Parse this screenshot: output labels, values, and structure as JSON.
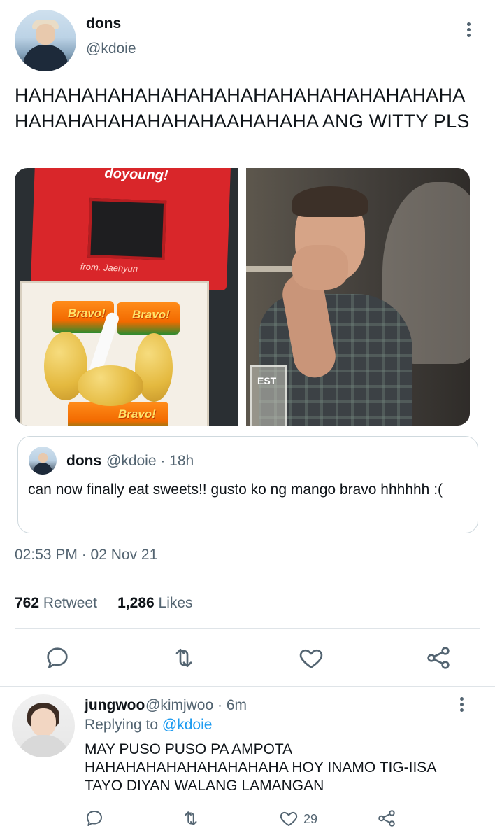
{
  "tweet": {
    "author_name": "dons",
    "author_handle": "@kdoie",
    "text": "HAHAHAHAHAHAHAHAHAHAHAHAHAHAHAHAHA HAHAHAHAHAHAHAHAAHAHAHA ANG WITTY PLS",
    "image_left_texts": {
      "bag_top": "doyoung!",
      "bag_from": "from. Jaehyun",
      "snack_brand": "Bravo!"
    },
    "image_right_texts": {
      "glass_label": "EST"
    },
    "quoted": {
      "author_name": "dons",
      "author_handle": "@kdoie · 18h",
      "text": "can now finally eat sweets!! gusto ko ng mango bravo hhhhhh :("
    },
    "timestamp": "02:53 PM · 02 Nov 21",
    "stats": {
      "retweet_count": "762",
      "retweet_label": "Retweet",
      "like_count": "1,286",
      "like_label": "Likes"
    }
  },
  "reply": {
    "author_name": "jungwoo",
    "author_handle": "@kimjwoo · 6m",
    "replying_prefix": "Replying to",
    "replying_to": "@kdoie",
    "text": "MAY PUSO PUSO PA AMPOTA HAHAHAHAHAHAHAHAHAHA HOY INAMO TIG-IISA TAYO DIYAN WALANG LAMANGAN",
    "like_count": "29"
  },
  "colors": {
    "text_primary": "#0f1419",
    "text_secondary": "#536471",
    "link": "#1d9bf0",
    "border": "#cfd9de"
  },
  "icons": [
    "more-icon",
    "reply-icon",
    "retweet-icon",
    "like-icon",
    "share-icon"
  ]
}
